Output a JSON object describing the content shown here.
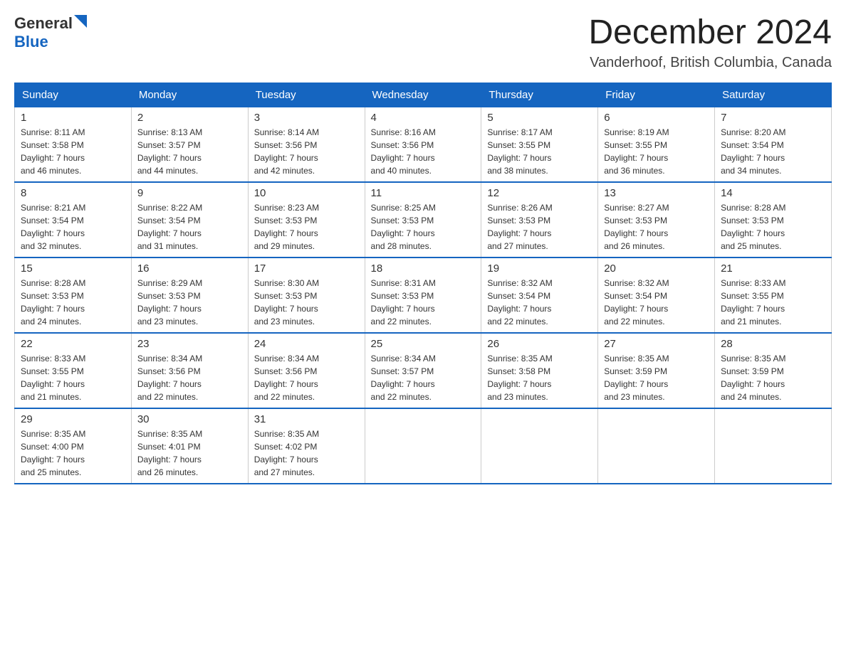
{
  "header": {
    "logo_general": "General",
    "logo_blue": "Blue",
    "month_year": "December 2024",
    "location": "Vanderhoof, British Columbia, Canada"
  },
  "columns": [
    "Sunday",
    "Monday",
    "Tuesday",
    "Wednesday",
    "Thursday",
    "Friday",
    "Saturday"
  ],
  "weeks": [
    [
      {
        "day": "1",
        "sunrise": "Sunrise: 8:11 AM",
        "sunset": "Sunset: 3:58 PM",
        "daylight": "Daylight: 7 hours",
        "minutes": "and 46 minutes."
      },
      {
        "day": "2",
        "sunrise": "Sunrise: 8:13 AM",
        "sunset": "Sunset: 3:57 PM",
        "daylight": "Daylight: 7 hours",
        "minutes": "and 44 minutes."
      },
      {
        "day": "3",
        "sunrise": "Sunrise: 8:14 AM",
        "sunset": "Sunset: 3:56 PM",
        "daylight": "Daylight: 7 hours",
        "minutes": "and 42 minutes."
      },
      {
        "day": "4",
        "sunrise": "Sunrise: 8:16 AM",
        "sunset": "Sunset: 3:56 PM",
        "daylight": "Daylight: 7 hours",
        "minutes": "and 40 minutes."
      },
      {
        "day": "5",
        "sunrise": "Sunrise: 8:17 AM",
        "sunset": "Sunset: 3:55 PM",
        "daylight": "Daylight: 7 hours",
        "minutes": "and 38 minutes."
      },
      {
        "day": "6",
        "sunrise": "Sunrise: 8:19 AM",
        "sunset": "Sunset: 3:55 PM",
        "daylight": "Daylight: 7 hours",
        "minutes": "and 36 minutes."
      },
      {
        "day": "7",
        "sunrise": "Sunrise: 8:20 AM",
        "sunset": "Sunset: 3:54 PM",
        "daylight": "Daylight: 7 hours",
        "minutes": "and 34 minutes."
      }
    ],
    [
      {
        "day": "8",
        "sunrise": "Sunrise: 8:21 AM",
        "sunset": "Sunset: 3:54 PM",
        "daylight": "Daylight: 7 hours",
        "minutes": "and 32 minutes."
      },
      {
        "day": "9",
        "sunrise": "Sunrise: 8:22 AM",
        "sunset": "Sunset: 3:54 PM",
        "daylight": "Daylight: 7 hours",
        "minutes": "and 31 minutes."
      },
      {
        "day": "10",
        "sunrise": "Sunrise: 8:23 AM",
        "sunset": "Sunset: 3:53 PM",
        "daylight": "Daylight: 7 hours",
        "minutes": "and 29 minutes."
      },
      {
        "day": "11",
        "sunrise": "Sunrise: 8:25 AM",
        "sunset": "Sunset: 3:53 PM",
        "daylight": "Daylight: 7 hours",
        "minutes": "and 28 minutes."
      },
      {
        "day": "12",
        "sunrise": "Sunrise: 8:26 AM",
        "sunset": "Sunset: 3:53 PM",
        "daylight": "Daylight: 7 hours",
        "minutes": "and 27 minutes."
      },
      {
        "day": "13",
        "sunrise": "Sunrise: 8:27 AM",
        "sunset": "Sunset: 3:53 PM",
        "daylight": "Daylight: 7 hours",
        "minutes": "and 26 minutes."
      },
      {
        "day": "14",
        "sunrise": "Sunrise: 8:28 AM",
        "sunset": "Sunset: 3:53 PM",
        "daylight": "Daylight: 7 hours",
        "minutes": "and 25 minutes."
      }
    ],
    [
      {
        "day": "15",
        "sunrise": "Sunrise: 8:28 AM",
        "sunset": "Sunset: 3:53 PM",
        "daylight": "Daylight: 7 hours",
        "minutes": "and 24 minutes."
      },
      {
        "day": "16",
        "sunrise": "Sunrise: 8:29 AM",
        "sunset": "Sunset: 3:53 PM",
        "daylight": "Daylight: 7 hours",
        "minutes": "and 23 minutes."
      },
      {
        "day": "17",
        "sunrise": "Sunrise: 8:30 AM",
        "sunset": "Sunset: 3:53 PM",
        "daylight": "Daylight: 7 hours",
        "minutes": "and 23 minutes."
      },
      {
        "day": "18",
        "sunrise": "Sunrise: 8:31 AM",
        "sunset": "Sunset: 3:53 PM",
        "daylight": "Daylight: 7 hours",
        "minutes": "and 22 minutes."
      },
      {
        "day": "19",
        "sunrise": "Sunrise: 8:32 AM",
        "sunset": "Sunset: 3:54 PM",
        "daylight": "Daylight: 7 hours",
        "minutes": "and 22 minutes."
      },
      {
        "day": "20",
        "sunrise": "Sunrise: 8:32 AM",
        "sunset": "Sunset: 3:54 PM",
        "daylight": "Daylight: 7 hours",
        "minutes": "and 22 minutes."
      },
      {
        "day": "21",
        "sunrise": "Sunrise: 8:33 AM",
        "sunset": "Sunset: 3:55 PM",
        "daylight": "Daylight: 7 hours",
        "minutes": "and 21 minutes."
      }
    ],
    [
      {
        "day": "22",
        "sunrise": "Sunrise: 8:33 AM",
        "sunset": "Sunset: 3:55 PM",
        "daylight": "Daylight: 7 hours",
        "minutes": "and 21 minutes."
      },
      {
        "day": "23",
        "sunrise": "Sunrise: 8:34 AM",
        "sunset": "Sunset: 3:56 PM",
        "daylight": "Daylight: 7 hours",
        "minutes": "and 22 minutes."
      },
      {
        "day": "24",
        "sunrise": "Sunrise: 8:34 AM",
        "sunset": "Sunset: 3:56 PM",
        "daylight": "Daylight: 7 hours",
        "minutes": "and 22 minutes."
      },
      {
        "day": "25",
        "sunrise": "Sunrise: 8:34 AM",
        "sunset": "Sunset: 3:57 PM",
        "daylight": "Daylight: 7 hours",
        "minutes": "and 22 minutes."
      },
      {
        "day": "26",
        "sunrise": "Sunrise: 8:35 AM",
        "sunset": "Sunset: 3:58 PM",
        "daylight": "Daylight: 7 hours",
        "minutes": "and 23 minutes."
      },
      {
        "day": "27",
        "sunrise": "Sunrise: 8:35 AM",
        "sunset": "Sunset: 3:59 PM",
        "daylight": "Daylight: 7 hours",
        "minutes": "and 23 minutes."
      },
      {
        "day": "28",
        "sunrise": "Sunrise: 8:35 AM",
        "sunset": "Sunset: 3:59 PM",
        "daylight": "Daylight: 7 hours",
        "minutes": "and 24 minutes."
      }
    ],
    [
      {
        "day": "29",
        "sunrise": "Sunrise: 8:35 AM",
        "sunset": "Sunset: 4:00 PM",
        "daylight": "Daylight: 7 hours",
        "minutes": "and 25 minutes."
      },
      {
        "day": "30",
        "sunrise": "Sunrise: 8:35 AM",
        "sunset": "Sunset: 4:01 PM",
        "daylight": "Daylight: 7 hours",
        "minutes": "and 26 minutes."
      },
      {
        "day": "31",
        "sunrise": "Sunrise: 8:35 AM",
        "sunset": "Sunset: 4:02 PM",
        "daylight": "Daylight: 7 hours",
        "minutes": "and 27 minutes."
      },
      null,
      null,
      null,
      null
    ]
  ]
}
